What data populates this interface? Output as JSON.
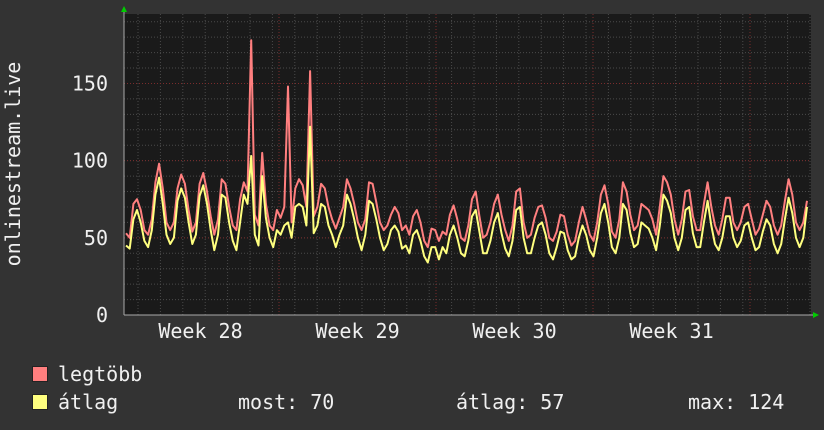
{
  "chart_data": {
    "type": "line",
    "ylabel": "onlinestream.live",
    "ylim": [
      0,
      195
    ],
    "yticks": [
      0,
      50,
      100,
      150
    ],
    "xtick_labels": [
      "Week 28",
      "Week 29",
      "Week 30",
      "Week 31"
    ],
    "grid": true,
    "legend_placement": "bottom-left",
    "series": [
      {
        "name": "legtöbb",
        "color": "#ff7f7f",
        "values": [
          53,
          50,
          72,
          75,
          68,
          55,
          52,
          62,
          86,
          98,
          82,
          60,
          55,
          60,
          82,
          91,
          85,
          68,
          54,
          60,
          85,
          92,
          80,
          64,
          52,
          62,
          88,
          85,
          70,
          58,
          55,
          75,
          86,
          80,
          178,
          65,
          58,
          105,
          72,
          58,
          55,
          68,
          63,
          70,
          148,
          60,
          82,
          88,
          84,
          70,
          158,
          64,
          70,
          85,
          82,
          70,
          62,
          56,
          63,
          70,
          88,
          82,
          72,
          60,
          55,
          62,
          86,
          85,
          73,
          60,
          55,
          58,
          65,
          70,
          66,
          55,
          58,
          52,
          64,
          68,
          60,
          48,
          44,
          56,
          55,
          48,
          54,
          52,
          65,
          71,
          62,
          50,
          48,
          58,
          75,
          80,
          64,
          50,
          52,
          60,
          72,
          78,
          65,
          55,
          48,
          58,
          80,
          82,
          60,
          50,
          52,
          63,
          70,
          71,
          63,
          50,
          48,
          54,
          65,
          64,
          52,
          45,
          48,
          60,
          70,
          62,
          52,
          48,
          60,
          78,
          84,
          72,
          54,
          50,
          62,
          86,
          80,
          65,
          55,
          58,
          72,
          70,
          68,
          62,
          52,
          70,
          90,
          86,
          78,
          62,
          52,
          62,
          80,
          81,
          64,
          55,
          55,
          72,
          86,
          70,
          58,
          52,
          62,
          76,
          76,
          60,
          55,
          60,
          70,
          72,
          62,
          52,
          56,
          65,
          74,
          70,
          58,
          52,
          58,
          74,
          88,
          78,
          60,
          55,
          60,
          74
        ],
        "note": "values approximated by reading the chart"
      },
      {
        "name": "átlag",
        "color": "#ffff7f",
        "values": [
          45,
          43,
          62,
          68,
          60,
          48,
          44,
          55,
          78,
          89,
          72,
          52,
          46,
          50,
          74,
          82,
          76,
          60,
          46,
          52,
          77,
          84,
          72,
          55,
          42,
          52,
          78,
          76,
          60,
          48,
          42,
          60,
          78,
          72,
          103,
          52,
          45,
          90,
          63,
          50,
          44,
          55,
          52,
          58,
          60,
          50,
          70,
          72,
          70,
          58,
          122,
          53,
          58,
          72,
          70,
          58,
          52,
          44,
          52,
          58,
          78,
          72,
          62,
          50,
          42,
          52,
          74,
          72,
          62,
          50,
          42,
          46,
          55,
          58,
          54,
          43,
          45,
          40,
          52,
          55,
          48,
          38,
          34,
          44,
          44,
          36,
          44,
          40,
          52,
          58,
          50,
          40,
          38,
          48,
          64,
          68,
          54,
          40,
          40,
          48,
          60,
          66,
          53,
          43,
          38,
          48,
          68,
          70,
          50,
          40,
          40,
          50,
          58,
          60,
          52,
          40,
          36,
          44,
          54,
          53,
          42,
          36,
          38,
          50,
          58,
          52,
          42,
          38,
          50,
          66,
          72,
          60,
          44,
          40,
          50,
          72,
          68,
          53,
          44,
          46,
          60,
          58,
          56,
          50,
          42,
          58,
          78,
          74,
          66,
          50,
          42,
          50,
          68,
          70,
          53,
          44,
          44,
          60,
          74,
          58,
          46,
          42,
          50,
          64,
          64,
          50,
          44,
          48,
          58,
          60,
          50,
          42,
          44,
          54,
          62,
          58,
          46,
          40,
          46,
          62,
          76,
          66,
          50,
          44,
          50,
          70
        ]
      }
    ]
  },
  "legend": {
    "max_label": "legtöbb",
    "avg_label": "átlag",
    "stats": {
      "now": "most: 70",
      "avg": "átlag: 57",
      "max": "max: 124"
    }
  },
  "colors": {
    "background": "#333333",
    "plot_background": "#1a1a1a",
    "grid_minor": "#4a4a4a",
    "grid_major": "#7a2c2c",
    "text": "#f0f0f0",
    "axis_arrow": "#00cc00"
  }
}
